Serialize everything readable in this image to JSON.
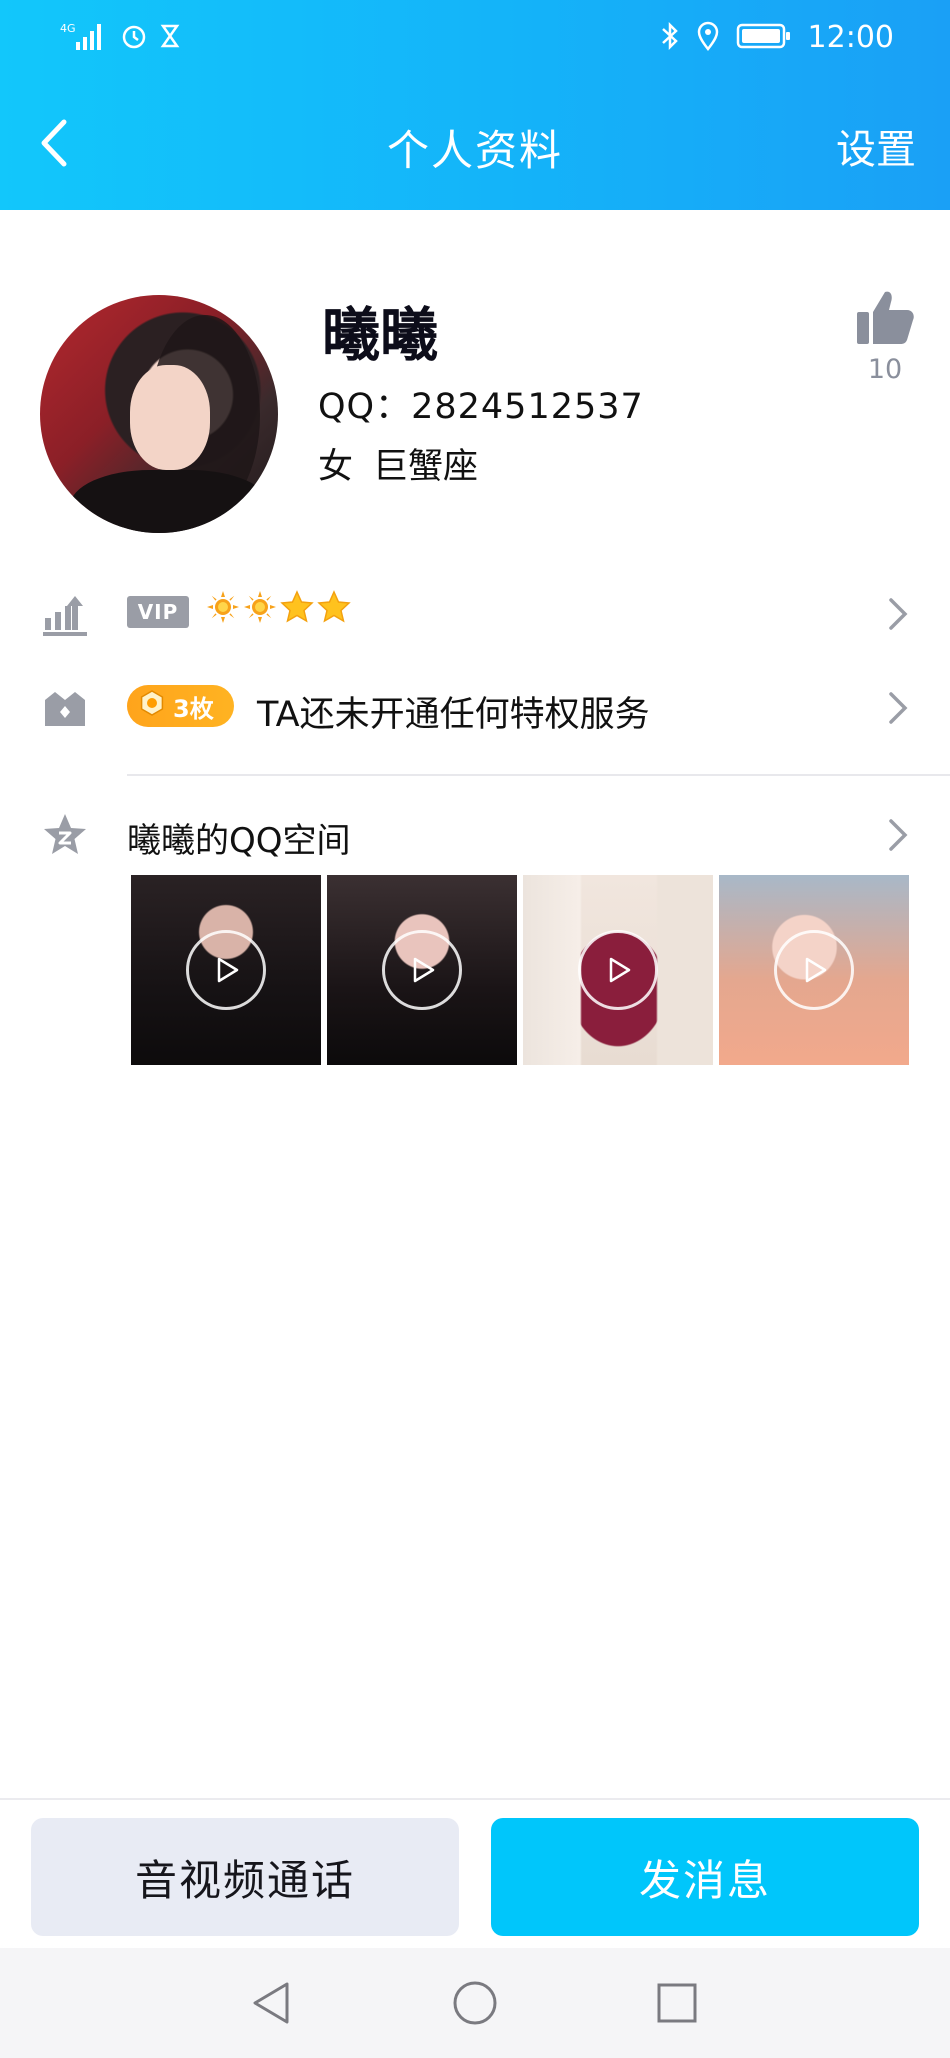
{
  "status_bar": {
    "network": "4G",
    "time": "12:00",
    "icons": [
      "signal-icon",
      "alarm-icon",
      "hourglass-icon",
      "bluetooth-icon",
      "location-icon",
      "battery-icon"
    ]
  },
  "nav": {
    "title": "个人资料",
    "settings_label": "设置",
    "back_icon": "back-icon"
  },
  "profile": {
    "nickname": "曦曦",
    "qq_label": "QQ：2824512537",
    "gender": "女",
    "constellation": "巨蟹座",
    "like_count": "10",
    "like_icon": "thumbs-up-icon"
  },
  "vip": {
    "badge": "VIP",
    "level_icons": [
      "sun",
      "sun",
      "star",
      "star"
    ]
  },
  "privilege": {
    "coin_count": "3枚",
    "text": "TA还未开通任何特权服务"
  },
  "qzone": {
    "label": "曦曦的QQ空间",
    "photos": [
      {
        "name": "video-thumb-1"
      },
      {
        "name": "video-thumb-2"
      },
      {
        "name": "video-thumb-3"
      },
      {
        "name": "video-thumb-4"
      }
    ]
  },
  "actions": {
    "call_label": "音视频通话",
    "message_label": "发消息"
  },
  "colors": {
    "header_gradient_start": "#12c7fb",
    "header_gradient_end": "#1aa0f6",
    "primary_button": "#00c6fb",
    "secondary_button": "#e8ebf4",
    "coin_badge": "#ffa41b",
    "icon_gray": "#9a9da6"
  }
}
